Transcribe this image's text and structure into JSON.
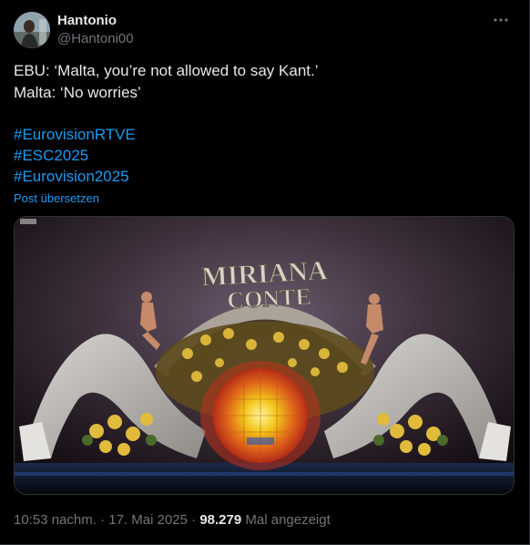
{
  "author": {
    "display_name": "Hantonio",
    "handle": "@Hantoni00"
  },
  "tweet": {
    "lines": [
      "EBU: ‘Malta, you’re not allowed to say Kant.’",
      "Malta: ‘No worries’"
    ],
    "hashtags": [
      "#EurovisionRTVE",
      "#ESC2025",
      "#Eurovision2025"
    ],
    "translate_label": "Post übersetzen"
  },
  "media": {
    "stage_title_line1": "MIRIANA",
    "stage_title_line2": "CONTE"
  },
  "meta": {
    "time": "10:53 nachm.",
    "sep1": " · ",
    "date": "17. Mai 2025",
    "sep2": " · ",
    "views": "98.279",
    "views_label": " Mal angezeigt"
  },
  "icons": {
    "more": "more-dots-icon"
  },
  "colors": {
    "background": "#000000",
    "text": "#e7e9ea",
    "secondary": "#71767b",
    "link": "#1d9bf0",
    "border": "#2f3336"
  }
}
